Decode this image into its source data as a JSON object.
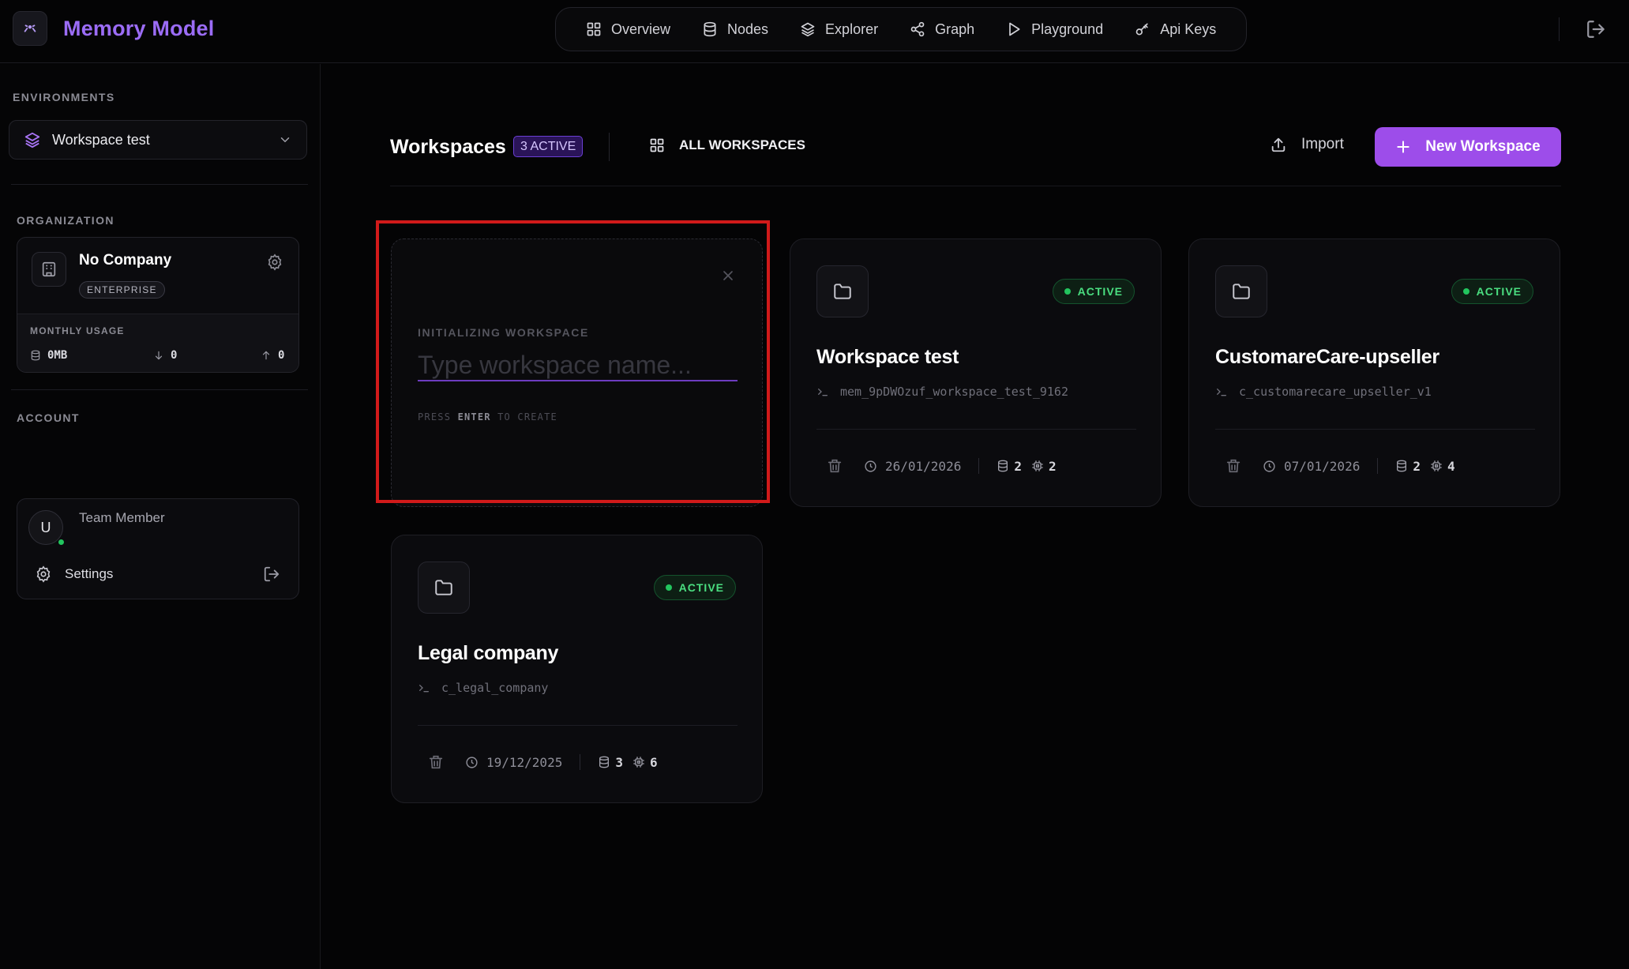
{
  "app": {
    "name": "Memory Model"
  },
  "nav": [
    {
      "label": "Overview",
      "icon": "grid-icon"
    },
    {
      "label": "Nodes",
      "icon": "database-icon"
    },
    {
      "label": "Explorer",
      "icon": "layers-icon"
    },
    {
      "label": "Graph",
      "icon": "share-icon"
    },
    {
      "label": "Playground",
      "icon": "play-icon"
    },
    {
      "label": "Api Keys",
      "icon": "key-icon"
    }
  ],
  "sidebar": {
    "environments_label": "ENVIRONMENTS",
    "environment_selected": "Workspace test",
    "organization_label": "ORGANIZATION",
    "org_name": "No Company",
    "org_plan": "ENTERPRISE",
    "usage_label": "MONTHLY USAGE",
    "usage_storage": "0MB",
    "usage_down": "0",
    "usage_up": "0",
    "account_label": "ACCOUNT",
    "avatar_initial": "U",
    "member_name": "Team Member",
    "settings_label": "Settings"
  },
  "main": {
    "title": "Workspaces",
    "active_badge": "3 ACTIVE",
    "all_workspaces_label": "ALL WORKSPACES",
    "import_label": "Import",
    "new_workspace_label": "New Workspace",
    "init": {
      "label": "INITIALIZING WORKSPACE",
      "placeholder": "Type workspace name...",
      "hint_press": "PRESS",
      "hint_key": "ENTER",
      "hint_create": "TO CREATE"
    },
    "workspaces": [
      {
        "name": "Workspace test",
        "id": "mem_9pDWOzuf_workspace_test_9162",
        "status": "ACTIVE",
        "date": "26/01/2026",
        "stat_a": "2",
        "stat_b": "2"
      },
      {
        "name": "CustomareCare-upseller",
        "id": "c_customarecare_upseller_v1",
        "status": "ACTIVE",
        "date": "07/01/2026",
        "stat_a": "2",
        "stat_b": "4"
      },
      {
        "name": "Legal company",
        "id": "c_legal_company",
        "status": "ACTIVE",
        "date": "19/12/2025",
        "stat_a": "3",
        "stat_b": "6"
      }
    ]
  },
  "colors": {
    "accent": "#9d4dea",
    "brand": "#9b6cf6",
    "active_green": "#4ade80",
    "highlight_red": "#d11a1a"
  }
}
